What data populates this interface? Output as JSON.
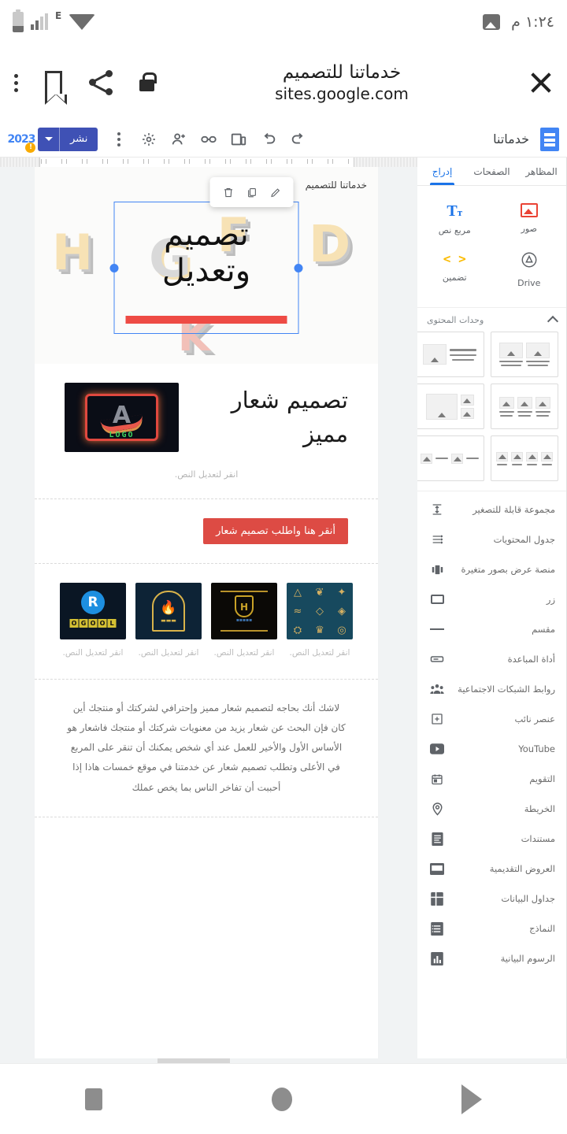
{
  "status_bar": {
    "time": "١:٢٤ م",
    "network_type": "E",
    "icons": [
      "battery-icon",
      "signal-icon",
      "edge-icon",
      "wifi-icon",
      "photo-icon"
    ]
  },
  "browser_header": {
    "site_title": "خدماتنا للتصميم",
    "url": "sites.google.com",
    "icons": [
      "more-options-icon",
      "bookmark-icon",
      "share-icon",
      "lock-icon",
      "close-icon"
    ]
  },
  "sites_toolbar": {
    "badge_year": "2023",
    "badge_warn": "!",
    "publish_label": "نشر",
    "site_name": "خدماتنا",
    "icons": [
      "more-vert-icon",
      "settings-icon",
      "add-person-icon",
      "link-icon",
      "preview-icon",
      "undo-icon",
      "redo-icon",
      "google-sites-icon"
    ]
  },
  "sidebar": {
    "tabs": [
      {
        "label": "إدراج",
        "active": true
      },
      {
        "label": "الصفحات",
        "active": false
      },
      {
        "label": "المظاهر",
        "active": false
      }
    ],
    "insert_items": [
      {
        "label": "مربع نص",
        "icon": "text-box-icon"
      },
      {
        "label": "صور",
        "icon": "images-icon"
      },
      {
        "label": "تضمين",
        "icon": "embed-icon"
      },
      {
        "label": "Drive",
        "icon": "drive-icon"
      }
    ],
    "section_title": "وحدات المحتوى",
    "layouts_count": 6,
    "list_items": [
      {
        "label": "مجموعة قابلة للتصغير",
        "icon": "collapsible-group-icon"
      },
      {
        "label": "جدول المحتويات",
        "icon": "table-of-contents-icon"
      },
      {
        "label": "منصة عرض بصور متغيرة",
        "icon": "image-carousel-icon"
      },
      {
        "label": "زر",
        "icon": "button-icon"
      },
      {
        "label": "مقسم",
        "icon": "divider-icon"
      },
      {
        "label": "أداة المباعدة",
        "icon": "spacer-icon"
      },
      {
        "label": "روابط الشبكات الاجتماعية",
        "icon": "social-links-icon"
      },
      {
        "label": "عنصر نائب",
        "icon": "placeholder-icon"
      },
      {
        "label": "YouTube",
        "icon": "youtube-icon"
      },
      {
        "label": "التقويم",
        "icon": "calendar-icon"
      },
      {
        "label": "الخريطة",
        "icon": "map-icon"
      },
      {
        "label": "مستندات",
        "icon": "docs-icon"
      },
      {
        "label": "العروض التقديمية",
        "icon": "slides-icon"
      },
      {
        "label": "جداول البيانات",
        "icon": "sheets-icon"
      },
      {
        "label": "النماذج",
        "icon": "forms-icon"
      },
      {
        "label": "الرسوم البيانية",
        "icon": "charts-icon"
      }
    ]
  },
  "canvas": {
    "hero": {
      "site_title": "خدماتنا للتصميم",
      "heading_line1": "تصميم",
      "heading_line2": "وتعديل",
      "accent_color": "#ee4b45",
      "selection_color": "#4285f4",
      "float_toolbar": [
        "delete-icon",
        "duplicate-icon",
        "edit-icon"
      ],
      "bg_letters": [
        "H",
        "G",
        "F",
        "D",
        "K"
      ]
    },
    "logo_section": {
      "heading": "تصميم شعار مميز",
      "hint": "انقر لتعديل النص.",
      "logo_caption": "LOGO",
      "logo_letter": "A"
    },
    "cta_button": {
      "label": "أنقر هنا واطلب تصميم شعار",
      "color": "#dd4b44"
    },
    "gallery": [
      {
        "caption": "انقر لتعديل النص.",
        "alt": "gold-emblems-grid"
      },
      {
        "caption": "انقر لتعديل النص.",
        "alt": "gold-shield-logo"
      },
      {
        "caption": "انقر لتعديل النص.",
        "alt": "gold-arch-flame-logo"
      },
      {
        "caption": "انقر لتعديل النص.",
        "alt": "blue-r-loogo"
      }
    ],
    "paragraph": "لاشك أنك بحاجه لتصميم شعار مميز وإحترافي لشركتك أو منتجك أين كان فإن البحث عن شعار يزيد من معنويات شركتك أو منتجك فاشعار هو الأساس الأول والأخير للعمل عند أي شخص يمكنك أن تنقر على المربع في الأعلى وتطلب تصميم شعار عن خدمتنا في موقع خمسات هاذا إذا أحببت أن تفاخر الناس بما يخص عملك"
  },
  "android_nav": {
    "buttons": [
      "recents-button",
      "home-button",
      "back-button"
    ]
  }
}
